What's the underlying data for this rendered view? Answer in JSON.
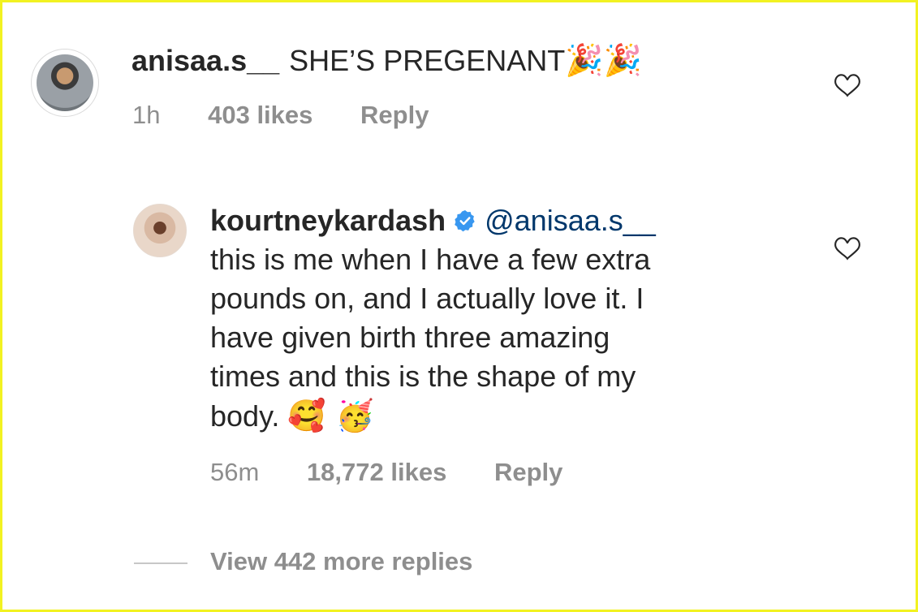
{
  "comment": {
    "username": "anisaa.s__",
    "text": "SHE’S PREGENANT",
    "emojis": "🎉🎉",
    "time": "1h",
    "likes": "403 likes",
    "reply_label": "Reply"
  },
  "reply": {
    "username": "kourtneykardash",
    "verified": true,
    "mention": "@anisaa.s__",
    "text": "this is me when I have a few extra\npounds on, and I actually love it.  I\nhave given birth three amazing\ntimes and this is the shape of my\nbody.",
    "emojis": "🥰 🥳",
    "time": "56m",
    "likes": "18,772 likes",
    "reply_label": "Reply"
  },
  "view_more": {
    "label": "View 442 more replies"
  },
  "icons": {
    "like": "heart-outline-icon",
    "verified": "verified-badge-icon"
  },
  "colors": {
    "text": "#262626",
    "secondary": "#8e8e8e",
    "mention": "#00376b",
    "verified": "#3897f0",
    "frame": "#f2f221"
  }
}
